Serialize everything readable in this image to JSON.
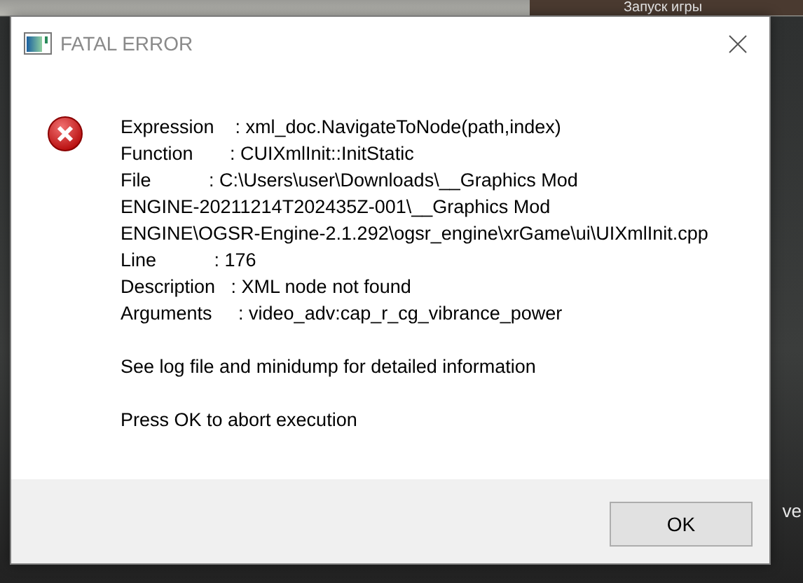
{
  "background": {
    "texts": [
      {
        "text": "Запуск игры",
        "kind": "top"
      },
      {
        "text": "ve",
        "kind": "right"
      }
    ]
  },
  "dialog": {
    "title": "FATAL ERROR",
    "lines": [
      {
        "text": "Expression    : xml_doc.NavigateToNode(path,index)"
      },
      {
        "text": "Function       : CUIXmlInit::InitStatic"
      },
      {
        "text": "File           : C:\\Users\\user\\Downloads\\__Graphics Mod"
      },
      {
        "text": "ENGINE-20211214T202435Z-001\\__Graphics Mod"
      },
      {
        "text": "ENGINE\\OGSR-Engine-2.1.292\\ogsr_engine\\xrGame\\ui\\UIXmlInit.cpp"
      },
      {
        "text": "Line           : 176"
      },
      {
        "text": "Description   : XML node not found"
      },
      {
        "text": "Arguments     : video_adv:cap_r_cg_vibrance_power"
      }
    ],
    "notes": [
      "See log file and minidump for detailed information",
      "Press OK to abort execution"
    ],
    "buttons": [
      "OK"
    ]
  }
}
